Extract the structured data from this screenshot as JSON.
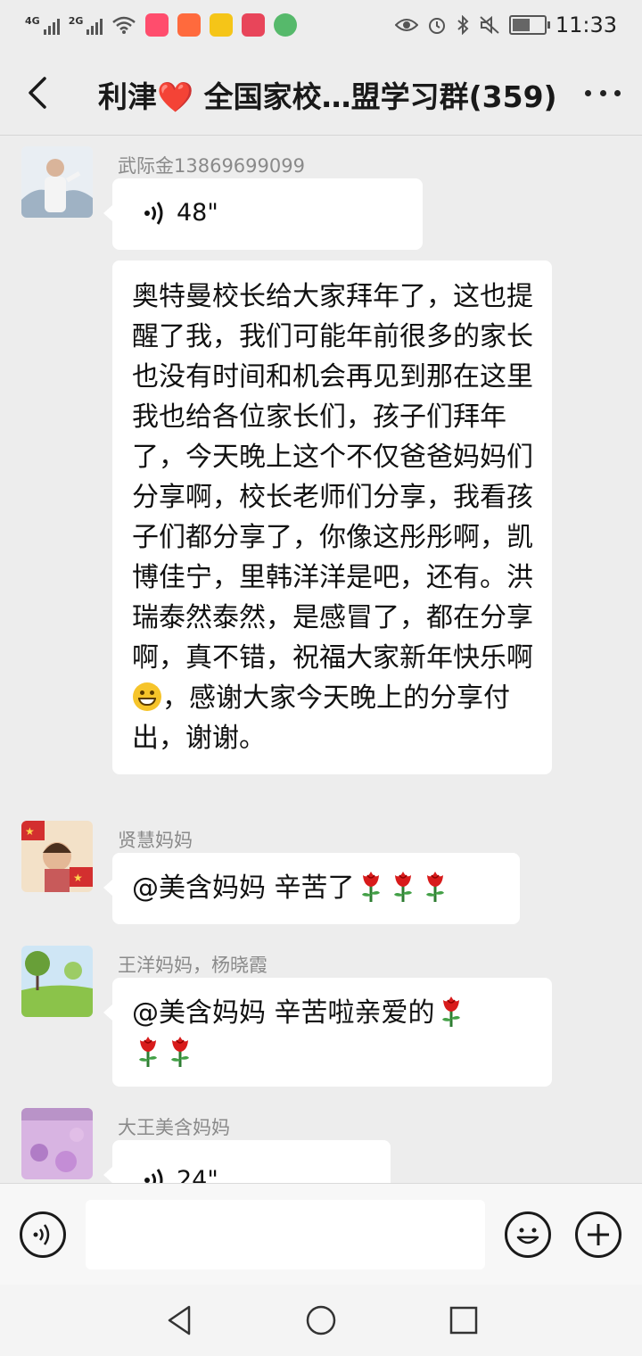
{
  "status_bar": {
    "network_1": "4G",
    "network_2": "2G",
    "time": "11:33",
    "battery_level": 0.6,
    "app_icon_colors": [
      "#ff4d6d",
      "#ff6a3d",
      "#f5c518",
      "#e8455a",
      "#56b96b"
    ]
  },
  "header": {
    "title": "利津❤️ 全国家校…盟学习群(359)",
    "back_icon": "chevron-left-icon",
    "more_icon": "more-dots-icon"
  },
  "messages": [
    {
      "sender": "武际金13869699099",
      "avatar_colors": [
        "#e8eef4",
        "#7d8da0"
      ],
      "voice_duration": "48\"",
      "text": "奥特曼校长给大家拜年了，这也提醒了我，我们可能年前很多的家长也没有时间和机会再见到那在这里我也给各位家长们，孩子们拜年了，今天晚上这个不仅爸爸妈妈们分享啊，校长老师们分享，我看孩子们都分享了，你像这彤彤啊，凯博佳宁，里韩洋洋是吧，还有。洪瑞泰然泰然，是感冒了，都在分享啊，真不错，祝福大家新年快乐啊",
      "text_after_emoji": "，感谢大家今天晚上的分享付出，谢谢。"
    },
    {
      "sender": "贤慧妈妈",
      "avatar_colors": [
        "#d32f2f",
        "#ffd54f"
      ],
      "text": "@美含妈妈  辛苦了"
    },
    {
      "sender": "王洋妈妈，杨晓霞",
      "avatar_colors": [
        "#8bc34a",
        "#c5e1a5"
      ],
      "text": "@美含妈妈  辛苦啦亲爱的"
    },
    {
      "sender": "大王美含妈妈",
      "avatar_colors": [
        "#b07cc6",
        "#e1bee7"
      ],
      "voice_duration": "24\""
    }
  ],
  "input_bar": {
    "voice_icon": "voice-mode-icon",
    "emoji_icon": "emoji-icon",
    "plus_icon": "plus-icon",
    "placeholder": ""
  },
  "nav_bar": {
    "back_icon": "nav-back-icon",
    "home_icon": "nav-home-icon",
    "recents_icon": "nav-recents-icon"
  },
  "colors": {
    "chat_background": "#ededed",
    "bubble": "#ffffff",
    "sender_name": "#8a8a8a",
    "rose": "#d81b1b"
  }
}
